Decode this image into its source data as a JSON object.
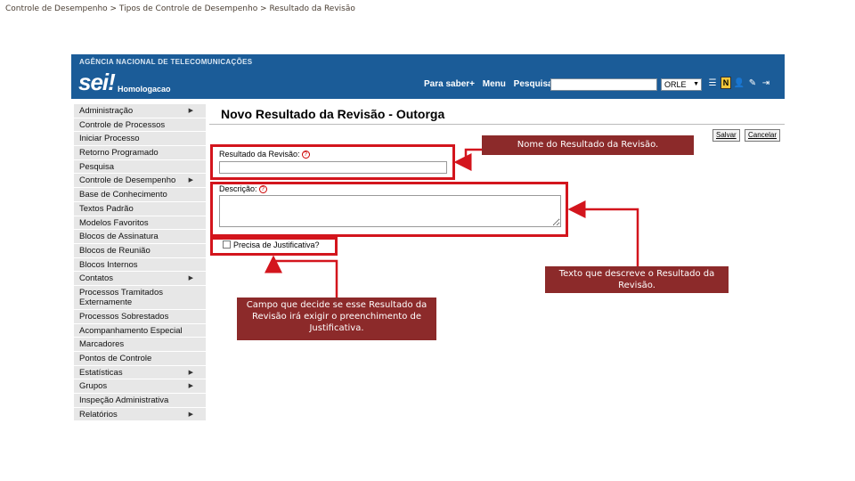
{
  "breadcrumb": "Controle de Desempenho > Tipos de Controle de Desempenho > Resultado da Revisão",
  "header": {
    "agency": "AGÊNCIA NACIONAL DE TELECOMUNICAÇÕES",
    "logo": "sei!",
    "environment": "Homologacao",
    "nav": [
      "Para saber+",
      "Menu",
      "Pesquisa"
    ],
    "search_value": "",
    "unit": "ORLE",
    "icons": [
      "notification-icon",
      "user-icon",
      "tools-icon",
      "exit-icon"
    ],
    "colors": {
      "bar": "#1b5c98"
    }
  },
  "sidebar": {
    "items": [
      {
        "label": "Administração",
        "submenu": true
      },
      {
        "label": "Controle de Processos",
        "submenu": false
      },
      {
        "label": "Iniciar Processo",
        "submenu": false
      },
      {
        "label": "Retorno Programado",
        "submenu": false
      },
      {
        "label": "Pesquisa",
        "submenu": false
      },
      {
        "label": "Controle de Desempenho",
        "submenu": true
      },
      {
        "label": "Base de Conhecimento",
        "submenu": false
      },
      {
        "label": "Textos Padrão",
        "submenu": false
      },
      {
        "label": "Modelos Favoritos",
        "submenu": false
      },
      {
        "label": "Blocos de Assinatura",
        "submenu": false
      },
      {
        "label": "Blocos de Reunião",
        "submenu": false
      },
      {
        "label": "Blocos Internos",
        "submenu": false
      },
      {
        "label": "Contatos",
        "submenu": true
      },
      {
        "label": "Processos Tramitados Externamente",
        "submenu": false
      },
      {
        "label": "Processos Sobrestados",
        "submenu": false
      },
      {
        "label": "Acompanhamento Especial",
        "submenu": false
      },
      {
        "label": "Marcadores",
        "submenu": false
      },
      {
        "label": "Pontos de Controle",
        "submenu": false
      },
      {
        "label": "Estatísticas",
        "submenu": true
      },
      {
        "label": "Grupos",
        "submenu": true
      },
      {
        "label": "Inspeção Administrativa",
        "submenu": false
      },
      {
        "label": "Relatórios",
        "submenu": true
      }
    ]
  },
  "form": {
    "title": "Novo Resultado da Revisão - Outorga",
    "save_label": "Salvar",
    "cancel_label": "Cancelar",
    "name_label": "Resultado da Revisão:",
    "name_value": "",
    "description_label": "Descrição:",
    "description_value": "",
    "justification_label": "Precisa de Justificativa?",
    "justification_checked": false
  },
  "annotations": {
    "name_note": "Nome do Resultado da Revisão.",
    "description_note": "Texto que descreve o Resultado da Revisão.",
    "justification_note": "Campo que decide se esse Resultado da Revisão irá exigir o preenchimento de Justificativa.",
    "colors": {
      "highlight": "#d3151d",
      "note_bg": "#8c2a2a"
    }
  }
}
